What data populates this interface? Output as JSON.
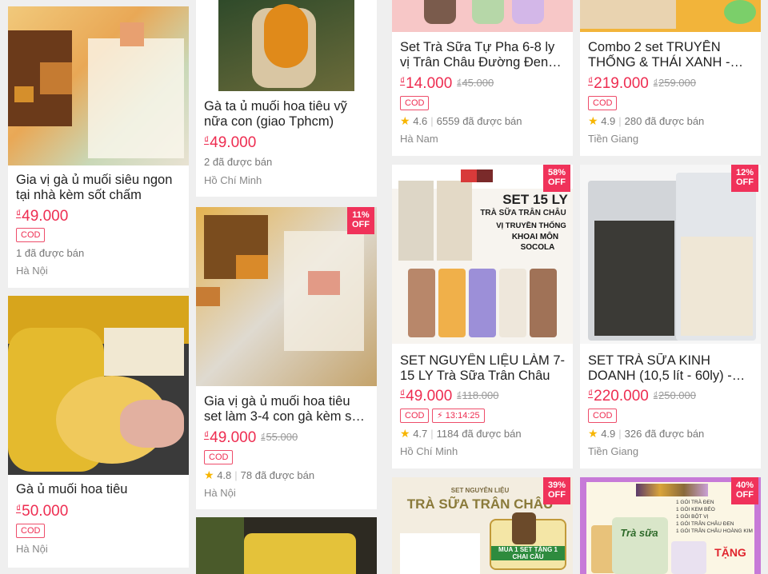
{
  "currency_symbol": "₫",
  "icons": {
    "star": "star-icon",
    "flash": "lightning-icon"
  },
  "colors": {
    "accent": "#ee2d51",
    "badge": "#f0325a",
    "star": "#f7b500"
  },
  "products": [
    {
      "title": "Gia vị gà ủ muối siêu ngon tại nhà kèm sốt chấm",
      "price": "49.000",
      "cod": "COD",
      "sold": "1 đã được bán",
      "location": "Hà Nội"
    },
    {
      "title": "Gà ủ muối hoa tiêu",
      "price": "50.000",
      "cod": "COD",
      "location": "Hà Nội"
    },
    {
      "title": "Gà ta ủ muối hoa tiêu vỹ nữa con (giao Tphcm)",
      "price": "49.000",
      "sold": "2 đã được bán",
      "location": "Hồ Chí Minh"
    },
    {
      "title": "Gia vị gà ủ muối hoa tiêu set làm 3-4 con gà kèm sốt ch...",
      "price": "49.000",
      "old_price": "55.000",
      "cod": "COD",
      "rating": "4.8",
      "sold": "78 đã được bán",
      "location": "Hà Nội",
      "discount": "11%",
      "off": "OFF"
    },
    {
      "title": "Set Trà Sữa Tự Pha 6-8 ly vị Trân Châu Đường Đen THE...",
      "price": "14.000",
      "old_price": "45.000",
      "cod": "COD",
      "rating": "4.6",
      "sold": "6559 đã được bán",
      "location": "Hà Nam"
    },
    {
      "title": "SET NGUYÊN LIỆU LÀM 7-15 LY Trà Sữa Trân Châu",
      "price": "49.000",
      "old_price": "118.000",
      "cod": "COD",
      "flash_time": "13:14:25",
      "rating": "4.7",
      "sold": "1184 đã được bán",
      "location": "Hồ Chí Minh",
      "discount": "58%",
      "off": "OFF",
      "image_text": {
        "line1": "SET 15 LY",
        "line2": "TRÀ SỮA TRÂN CHÂU",
        "line3": "VỊ TRUYỀN THỐNG",
        "line4": "KHOAI MÔN",
        "line5": "SOCOLA"
      }
    },
    {
      "discount": "39%",
      "off": "OFF",
      "image_text": {
        "line1": "SET NGUYÊN LIỆU",
        "line2": "TRÀ SỮA TRÂN CHÂU",
        "line3": "MUA 1 SET TẶNG 1 CHAI CẦU"
      }
    },
    {
      "title": "Combo 2 set TRUYỀN THỐNG & THÁI XANH - Ng...",
      "price": "219.000",
      "old_price": "259.000",
      "cod": "COD",
      "rating": "4.9",
      "sold": "280 đã được bán",
      "location": "Tiền Giang"
    },
    {
      "title": "SET TRÀ SỮA KINH DOANH (10,5 lít - 60ly) - Tặng công...",
      "price": "220.000",
      "old_price": "250.000",
      "cod": "COD",
      "rating": "4.9",
      "sold": "326 đã được bán",
      "location": "Tiền Giang",
      "discount": "12%",
      "off": "OFF"
    },
    {
      "discount": "40%",
      "off": "OFF",
      "image_text": {
        "line1": "1 GÓI TRÀ ĐEN",
        "line2": "1 GÓI KEM BÉO",
        "line3": "1 GÓI BỘT VỊ",
        "line4": "1 GÓI TRÂN CHÂU ĐEN",
        "line5": "1 GÓI TRÂN CHÂU HOÀNG KIM",
        "brand": "Trà sữa",
        "gift": "TẶNG"
      }
    }
  ]
}
